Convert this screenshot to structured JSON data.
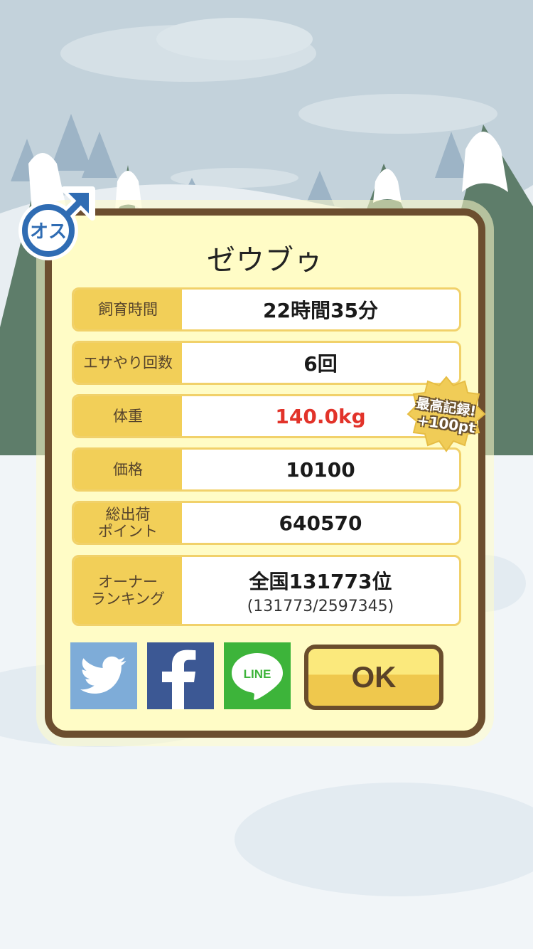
{
  "pet_name": "ゼウブゥ",
  "gender_badge": {
    "label": "オス",
    "icon": "male-symbol-icon",
    "color": "#2f6cb3"
  },
  "stats": [
    {
      "label": "飼育時間",
      "value": "22時間35分"
    },
    {
      "label": "エサやり回数",
      "value": "6回"
    },
    {
      "label": "体重",
      "value": "140.0kg",
      "highlight_color": "#e2332a"
    },
    {
      "label": "価格",
      "value": "10100"
    },
    {
      "label_line1": "総出荷",
      "label_line2": "ポイント",
      "value": "640570"
    }
  ],
  "ranking": {
    "label_line1": "オーナー",
    "label_line2": "ランキング",
    "value": "全国131773位",
    "detail": "(131773/2597345)"
  },
  "record_badge": {
    "line1": "最高記録!",
    "line2": "+100pt"
  },
  "share_buttons": [
    {
      "name": "twitter",
      "icon": "twitter-bird-icon",
      "color": "#7eacd8"
    },
    {
      "name": "facebook",
      "icon": "facebook-f-icon",
      "color": "#3c5894"
    },
    {
      "name": "line",
      "icon": "line-logo-icon",
      "label": "LINE",
      "color": "#3db43a"
    }
  ],
  "ok_button": {
    "label": "OK"
  }
}
